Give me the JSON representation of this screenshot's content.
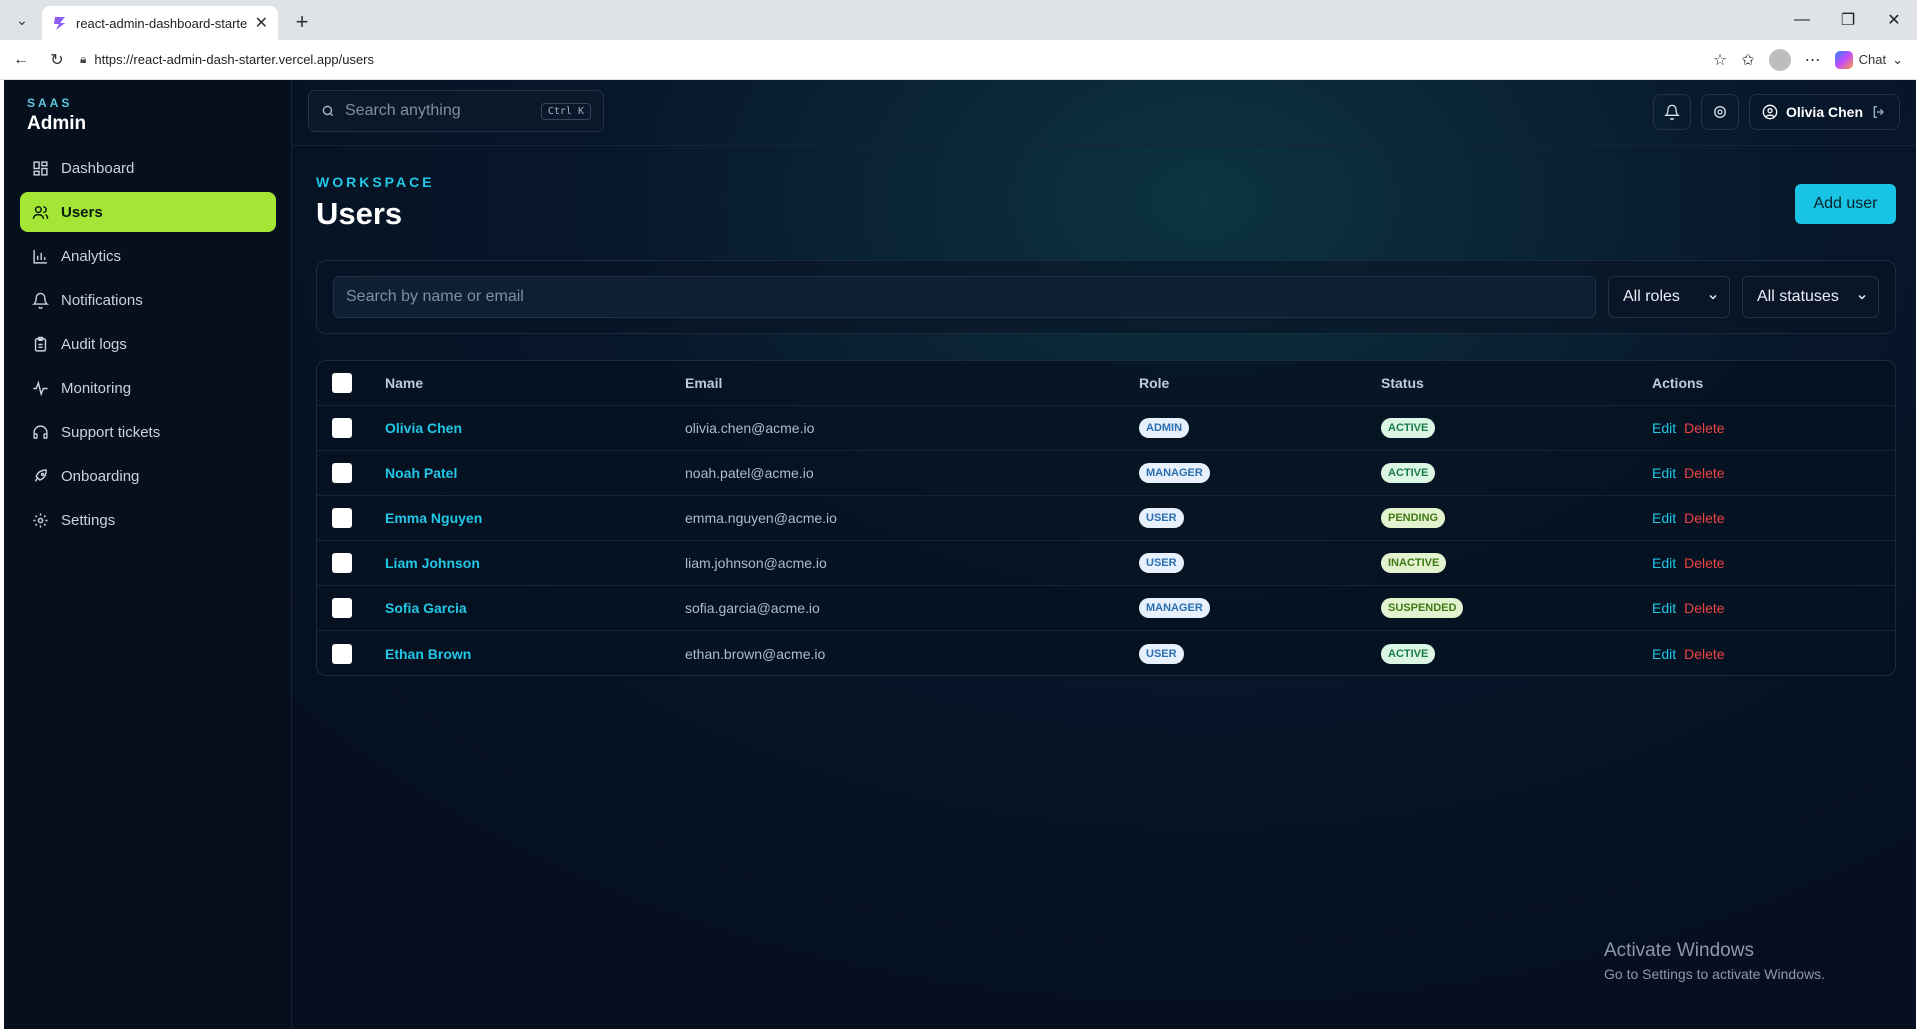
{
  "browser": {
    "tab_title": "react-admin-dashboard-starter-te",
    "url": "https://react-admin-dash-starter.vercel.app/users",
    "chat_label": "Chat"
  },
  "brand": {
    "kicker": "SAAS",
    "name": "Admin"
  },
  "sidebar": {
    "items": [
      {
        "label": "Dashboard",
        "icon": "grid-icon",
        "active": false
      },
      {
        "label": "Users",
        "icon": "users-icon",
        "active": true
      },
      {
        "label": "Analytics",
        "icon": "bar-chart-icon",
        "active": false
      },
      {
        "label": "Notifications",
        "icon": "bell-icon",
        "active": false
      },
      {
        "label": "Audit logs",
        "icon": "clipboard-icon",
        "active": false
      },
      {
        "label": "Monitoring",
        "icon": "activity-icon",
        "active": false
      },
      {
        "label": "Support tickets",
        "icon": "headset-icon",
        "active": false
      },
      {
        "label": "Onboarding",
        "icon": "rocket-icon",
        "active": false
      },
      {
        "label": "Settings",
        "icon": "gear-icon",
        "active": false
      }
    ]
  },
  "topbar": {
    "search_placeholder": "Search anything",
    "shortcut": "Ctrl K",
    "user_name": "Olivia Chen"
  },
  "page": {
    "eyebrow": "WORKSPACE",
    "title": "Users",
    "add_button": "Add user"
  },
  "filters": {
    "search_placeholder": "Search by name or email",
    "role_select": "All roles",
    "status_select": "All statuses"
  },
  "table": {
    "headers": {
      "name": "Name",
      "email": "Email",
      "role": "Role",
      "status": "Status",
      "actions": "Actions"
    },
    "edit_label": "Edit",
    "delete_label": "Delete",
    "rows": [
      {
        "name": "Olivia Chen",
        "email": "olivia.chen@acme.io",
        "role": "ADMIN",
        "status": "ACTIVE"
      },
      {
        "name": "Noah Patel",
        "email": "noah.patel@acme.io",
        "role": "MANAGER",
        "status": "ACTIVE"
      },
      {
        "name": "Emma Nguyen",
        "email": "emma.nguyen@acme.io",
        "role": "USER",
        "status": "PENDING"
      },
      {
        "name": "Liam Johnson",
        "email": "liam.johnson@acme.io",
        "role": "USER",
        "status": "INACTIVE"
      },
      {
        "name": "Sofia Garcia",
        "email": "sofia.garcia@acme.io",
        "role": "MANAGER",
        "status": "SUSPENDED"
      },
      {
        "name": "Ethan Brown",
        "email": "ethan.brown@acme.io",
        "role": "USER",
        "status": "ACTIVE"
      }
    ]
  },
  "watermark": {
    "line1": "Activate Windows",
    "line2": "Go to Settings to activate Windows."
  },
  "colors": {
    "accent": "#22c7e6",
    "active_nav": "#a3e635",
    "danger": "#ef4444",
    "background": "#050f1f"
  }
}
